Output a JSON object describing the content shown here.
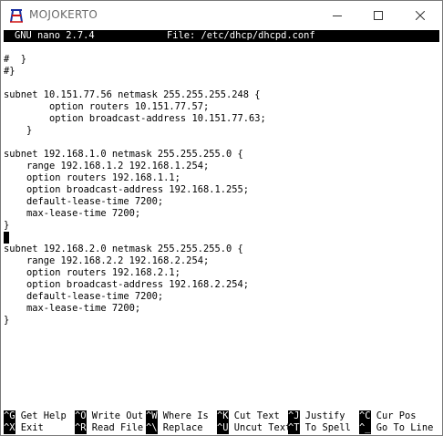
{
  "window": {
    "title": "MOJOKERTO",
    "buttons": {
      "minimize": "—",
      "maximize": "☐",
      "close": "✕"
    }
  },
  "nano": {
    "version": "GNU nano 2.7.4",
    "file": "File: /etc/dhcp/dhcpd.conf"
  },
  "content_lines": [
    "#  }",
    "#}",
    "",
    "subnet 10.151.77.56 netmask 255.255.255.248 {",
    "        option routers 10.151.77.57;",
    "        option broadcast-address 10.151.77.63;",
    "    }",
    "",
    "subnet 192.168.1.0 netmask 255.255.255.0 {",
    "    range 192.168.1.2 192.168.1.254;",
    "    option routers 192.168.1.1;",
    "    option broadcast-address 192.168.1.255;",
    "    default-lease-time 7200;",
    "    max-lease-time 7200;",
    "}",
    "",
    "subnet 192.168.2.0 netmask 255.255.255.0 {",
    "    range 192.168.2.2 192.168.2.254;",
    "    option routers 192.168.2.1;",
    "    option broadcast-address 192.168.2.254;",
    "    default-lease-time 7200;",
    "    max-lease-time 7200;",
    "}"
  ],
  "cursor_line_index": 15,
  "shortcuts": [
    {
      "key": "^G",
      "label": "Get Help"
    },
    {
      "key": "^O",
      "label": "Write Out"
    },
    {
      "key": "^W",
      "label": "Where Is"
    },
    {
      "key": "^K",
      "label": "Cut Text"
    },
    {
      "key": "^J",
      "label": "Justify"
    },
    {
      "key": "^C",
      "label": "Cur Pos"
    },
    {
      "key": "^X",
      "label": "Exit"
    },
    {
      "key": "^R",
      "label": "Read File"
    },
    {
      "key": "^\\",
      "label": "Replace"
    },
    {
      "key": "^U",
      "label": "Uncut Text"
    },
    {
      "key": "^T",
      "label": "To Spell"
    },
    {
      "key": "^_",
      "label": "Go To Line"
    }
  ],
  "colors": {
    "terminal_bg": "#ffffff",
    "terminal_fg": "#000000",
    "highlight_bg": "#000000",
    "highlight_fg": "#ffffff"
  }
}
